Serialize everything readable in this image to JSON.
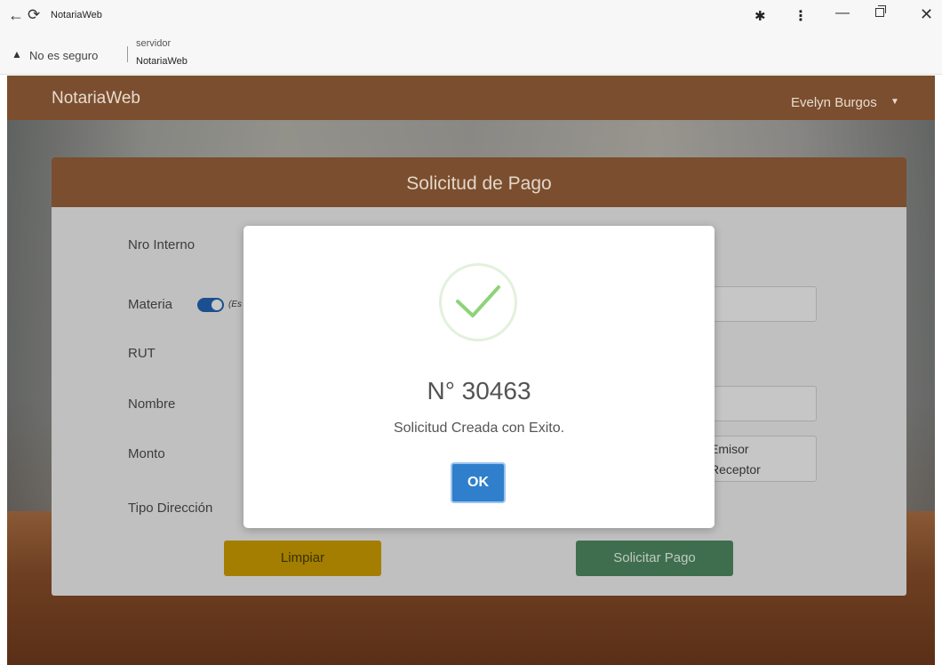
{
  "browser": {
    "tab_title": "NotariaWeb",
    "security_label": "No es seguro",
    "host": "servidor",
    "page_path": "NotariaWeb",
    "icons": {
      "back": "back-arrow-icon",
      "reload": "reload-icon",
      "extensions": "puzzle-icon",
      "menu": "kebab-menu-icon",
      "minimize": "minimize-icon",
      "maximize": "restore-icon",
      "close": "close-icon",
      "warning": "warning-icon"
    }
  },
  "navbar": {
    "brand": "NotariaWeb",
    "user": "Evelyn Burgos"
  },
  "form": {
    "title": "Solicitud de Pago",
    "labels": {
      "nro_interno": "Nro Interno",
      "materia": "Materia",
      "materia_hint": "(Es",
      "rut": "RUT",
      "nombre": "Nombre",
      "monto": "Monto",
      "tipo_direccion": "Tipo Dirección"
    },
    "options": {
      "emisor": "Emisor",
      "receptor": "Receptor"
    },
    "buttons": {
      "clear": "Limpiar",
      "request": "Solicitar Pago"
    }
  },
  "modal": {
    "number": "N° 30463",
    "message": "Solicitud Creada con Exito.",
    "ok": "OK"
  },
  "colors": {
    "brand_brown": "#7a4e2e",
    "success_green": "#8ed37a",
    "ok_blue": "#2f7fcc",
    "clear_yellow": "#a37e00",
    "request_green": "#3f6e4e"
  }
}
